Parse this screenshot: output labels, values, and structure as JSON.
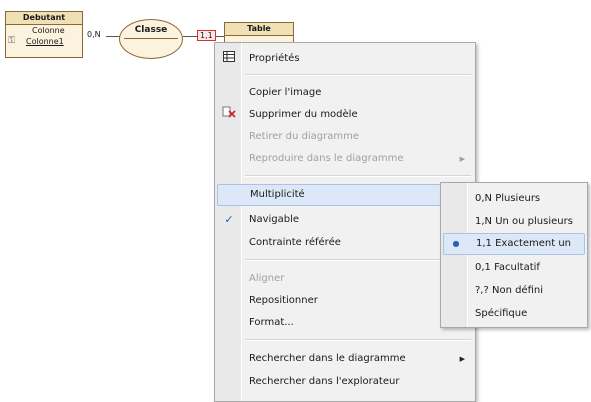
{
  "diagram": {
    "entity_debutant": {
      "title": "Debutant",
      "rows": [
        "Colonne",
        "Colonne1"
      ]
    },
    "card_left": "0,N",
    "association": "Classe",
    "card_right": "1,1",
    "entity_table": {
      "title": "Table"
    }
  },
  "context_menu": {
    "items": [
      {
        "label": "Propriétés",
        "icon": "table-properties-icon",
        "enabled": true
      },
      {
        "label": "Copier l'image",
        "enabled": true
      },
      {
        "label": "Supprimer du modèle",
        "icon": "delete-icon",
        "enabled": true
      },
      {
        "label": "Retirer du diagramme",
        "enabled": false
      },
      {
        "label": "Reproduire dans le diagramme",
        "enabled": false,
        "submenu": true
      },
      {
        "label": "Multiplicité",
        "enabled": true,
        "submenu": true,
        "highlighted": true
      },
      {
        "label": "Navigable",
        "enabled": true,
        "checked": true
      },
      {
        "label": "Contrainte référée",
        "enabled": true,
        "submenu": true
      },
      {
        "label": "Aligner",
        "enabled": false,
        "submenu": true
      },
      {
        "label": "Repositionner",
        "enabled": true
      },
      {
        "label": "Format...",
        "enabled": true
      },
      {
        "label": "Rechercher dans le diagramme",
        "enabled": true,
        "submenu": true
      },
      {
        "label": "Rechercher dans l'explorateur",
        "enabled": true
      }
    ]
  },
  "multiplicity_submenu": {
    "items": [
      {
        "label": "0,N Plusieurs"
      },
      {
        "label": "1,N Un ou plusieurs"
      },
      {
        "label": "1,1 Exactement un",
        "selected": true
      },
      {
        "label": "0,1 Facultatif"
      },
      {
        "label": "?,? Non défini"
      },
      {
        "label": "Spécifique"
      }
    ]
  },
  "glyphs": {
    "submenu_arrow": "▶",
    "check": "✓",
    "radio": "●",
    "delete": "✗",
    "key": "⚿"
  },
  "colors": {
    "highlight": "#dce8f7",
    "check": "#2b5fb8",
    "delete": "#d02020"
  }
}
